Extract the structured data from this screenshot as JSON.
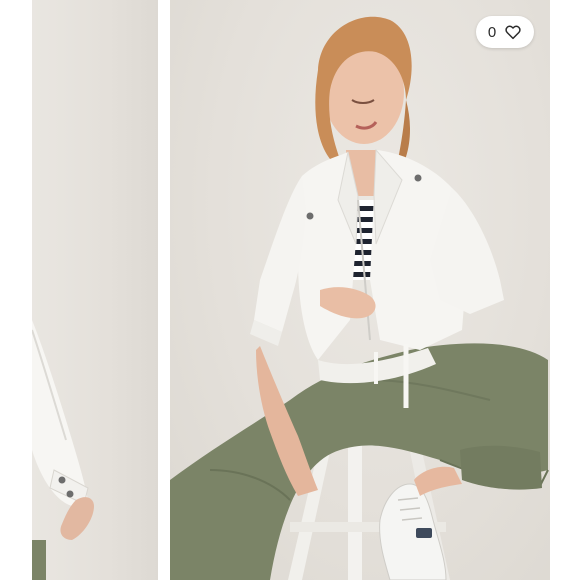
{
  "listing": {
    "like_count": "0"
  },
  "icons": {
    "like": "heart-outline-icon"
  },
  "colors": {
    "jacket": "#f6f5f2",
    "pants": "#7b8467",
    "backdrop": "#e6e2dc"
  }
}
